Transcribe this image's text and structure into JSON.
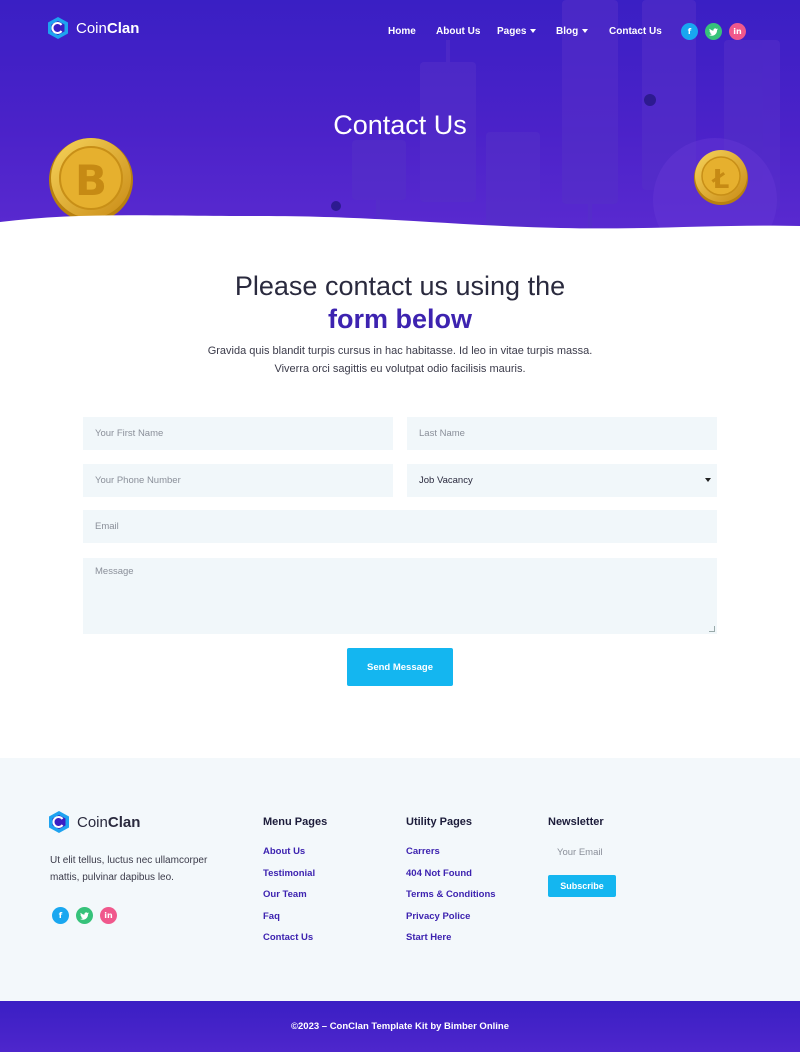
{
  "brand": {
    "name_light": "Coin",
    "name_bold": "Clan"
  },
  "nav": {
    "items": [
      "Home",
      "About Us",
      "Pages",
      "Blog",
      "Contact Us"
    ],
    "social": [
      "f",
      "t",
      "in"
    ]
  },
  "hero": {
    "title": "Contact Us"
  },
  "contact": {
    "heading_line1": "Please contact us using the",
    "heading_line2": "form below",
    "intro": "Gravida quis blandit turpis cursus in hac habitasse. Id leo in vitae turpis massa. Viverra orci sagittis eu volutpat odio facilisis mauris.",
    "fields": {
      "first_name": "Your First Name",
      "last_name": "Last Name",
      "phone": "Your Phone Number",
      "job": "Job Vacancy",
      "email": "Email",
      "message": "Message"
    },
    "submit": "Send Message"
  },
  "footer": {
    "description": "Ut elit tellus, luctus nec ullamcorper mattis, pulvinar dapibus leo.",
    "menu_pages": {
      "title": "Menu Pages",
      "items": [
        "About Us",
        "Testimonial",
        "Our Team",
        "Faq",
        "Contact Us"
      ]
    },
    "utility_pages": {
      "title": "Utility Pages",
      "items": [
        "Carrers",
        "404 Not Found",
        "Terms & Conditions",
        "Privacy Police",
        "Start Here"
      ]
    },
    "newsletter": {
      "title": "Newsletter",
      "placeholder": "Your Email",
      "button": "Subscribe"
    }
  },
  "copyright": "©2023 – ConClan Template Kit by Bimber Online",
  "colors": {
    "primary": "#3d23b0",
    "accent": "#14b6f0",
    "hero": "#4b22c9",
    "footer_bg": "#f3f8fb"
  }
}
